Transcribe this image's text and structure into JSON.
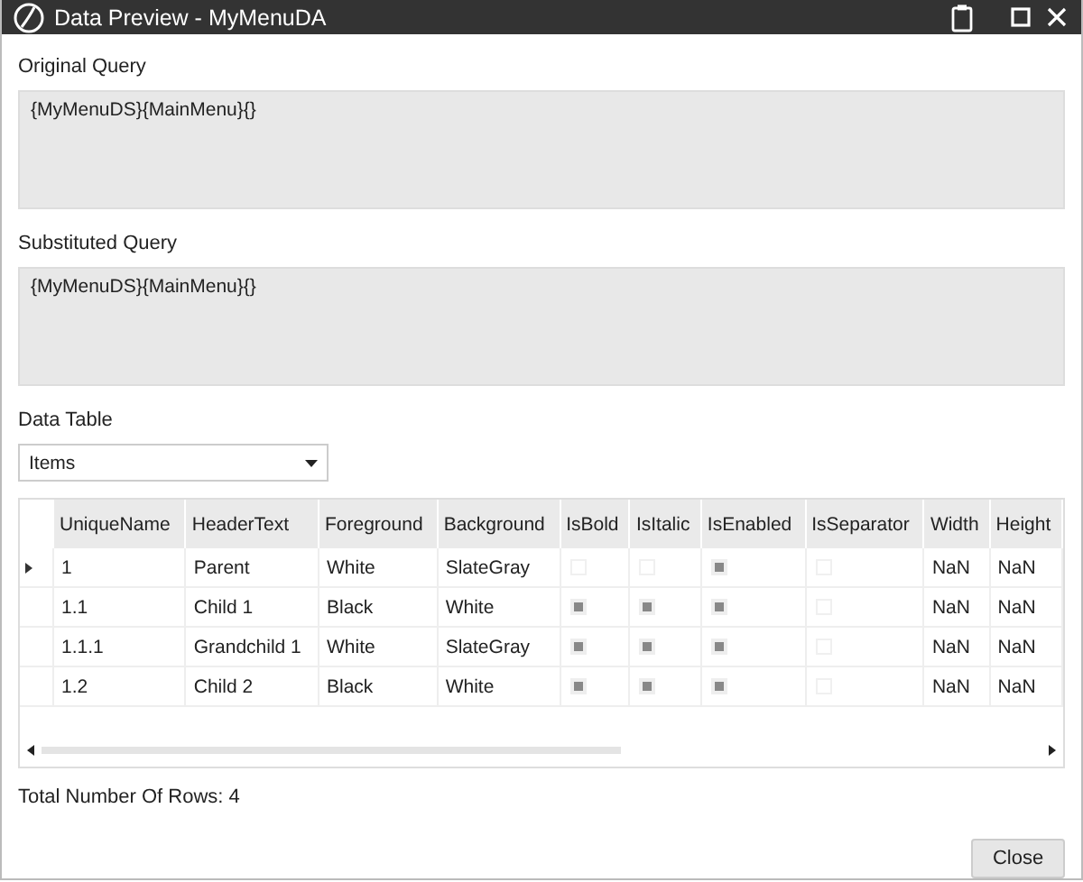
{
  "window": {
    "title": "Data Preview - MyMenuDA"
  },
  "original_query": {
    "label": "Original Query",
    "value": "{MyMenuDS}{MainMenu}{}"
  },
  "substituted_query": {
    "label": "Substituted Query",
    "value": "{MyMenuDS}{MainMenu}{}"
  },
  "data_table": {
    "label": "Data Table",
    "dropdown": {
      "value": "Items"
    }
  },
  "table": {
    "columns": [
      {
        "label": "UniqueName",
        "kind": "text"
      },
      {
        "label": "HeaderText",
        "kind": "text"
      },
      {
        "label": "Foreground",
        "kind": "text"
      },
      {
        "label": "Background",
        "kind": "text"
      },
      {
        "label": "IsBold",
        "kind": "check"
      },
      {
        "label": "IsItalic",
        "kind": "check"
      },
      {
        "label": "IsEnabled",
        "kind": "check"
      },
      {
        "label": "IsSeparator",
        "kind": "check"
      },
      {
        "label": "Width",
        "kind": "text"
      },
      {
        "label": "Height",
        "kind": "text"
      }
    ],
    "rows": [
      {
        "current": true,
        "cells": [
          "1",
          "Parent",
          "White",
          "SlateGray",
          {
            "checked": false
          },
          {
            "checked": false
          },
          {
            "checked": true
          },
          {
            "checked": false
          },
          "NaN",
          "NaN"
        ]
      },
      {
        "current": false,
        "cells": [
          "1.1",
          "Child 1",
          "Black",
          "White",
          {
            "checked": true
          },
          {
            "checked": true
          },
          {
            "checked": true
          },
          {
            "checked": false
          },
          "NaN",
          "NaN"
        ]
      },
      {
        "current": false,
        "cells": [
          "1.1.1",
          "Grandchild 1",
          "White",
          "SlateGray",
          {
            "checked": true
          },
          {
            "checked": true
          },
          {
            "checked": true
          },
          {
            "checked": false
          },
          "NaN",
          "NaN"
        ]
      },
      {
        "current": false,
        "cells": [
          "1.2",
          "Child 2",
          "Black",
          "White",
          {
            "checked": true
          },
          {
            "checked": true
          },
          {
            "checked": true
          },
          {
            "checked": false
          },
          "NaN",
          "NaN"
        ]
      }
    ]
  },
  "total_rows": "Total Number Of Rows: 4",
  "buttons": [
    "Close"
  ]
}
